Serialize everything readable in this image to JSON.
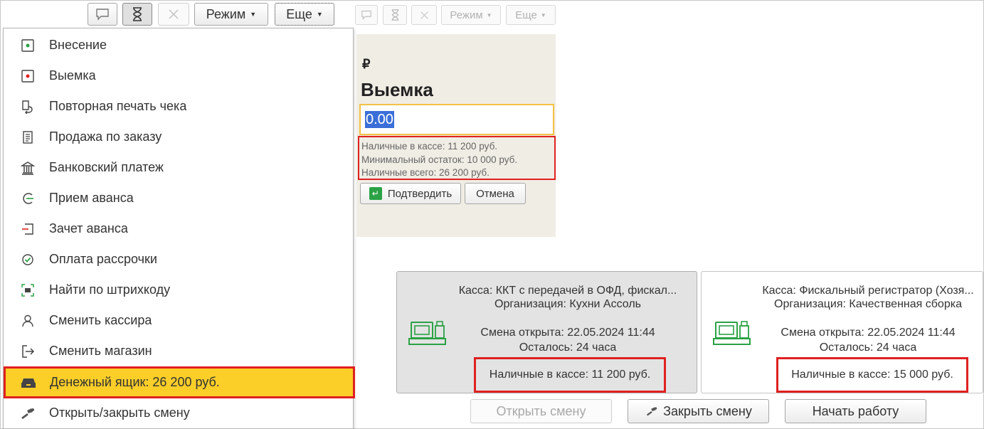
{
  "toolbar": {
    "mode_label": "Режим",
    "more_label": "Еще"
  },
  "menu": {
    "items": [
      {
        "label": "Внесение",
        "icon": "cash-in-icon"
      },
      {
        "label": "Выемка",
        "icon": "cash-out-icon"
      },
      {
        "label": "Повторная печать чека",
        "icon": "reprint-receipt-icon"
      },
      {
        "label": "Продажа по заказу",
        "icon": "order-sale-icon"
      },
      {
        "label": "Банковский платеж",
        "icon": "bank-icon"
      },
      {
        "label": "Прием аванса",
        "icon": "advance-receive-icon"
      },
      {
        "label": "Зачет аванса",
        "icon": "advance-offset-icon"
      },
      {
        "label": "Оплата рассрочки",
        "icon": "installment-icon"
      },
      {
        "label": "Найти по штрихкоду",
        "icon": "barcode-icon"
      },
      {
        "label": "Сменить кассира",
        "icon": "user-icon"
      },
      {
        "label": "Сменить магазин",
        "icon": "exit-icon"
      },
      {
        "label": "Денежный ящик: 26 200 руб.",
        "icon": "cash-drawer-icon"
      },
      {
        "label": "Открыть/закрыть смену",
        "icon": "shift-icon"
      }
    ]
  },
  "withdraw": {
    "currency_symbol": "₽",
    "title": "Выемка",
    "amount": "0.00",
    "cash_in_register": "Наличные в кассе: 11 200 руб.",
    "minimum_balance": "Минимальный остаток: 10 000 руб.",
    "cash_total": "Наличные всего: 26 200 руб.",
    "confirm_label": "Подтвердить",
    "cancel_label": "Отмена"
  },
  "registers": [
    {
      "register": "Касса: ККТ с передачей в ОФД, фискал...",
      "organization": "Организация: Кухни Ассоль",
      "shift_opened": "Смена открыта: 22.05.2024 11:44",
      "remaining": "Осталось: 24 часа",
      "cash": "Наличные в кассе: 11 200 руб."
    },
    {
      "register": "Касса: Фискальный регистратор (Хозя...",
      "organization": "Организация: Качественная сборка",
      "shift_opened": "Смена открыта: 22.05.2024 11:44",
      "remaining": "Осталось: 24 часа",
      "cash": "Наличные в кассе: 15 000 руб."
    }
  ],
  "actions": {
    "open_shift": "Открыть смену",
    "close_shift": "Закрыть смену",
    "start_work": "Начать работу"
  },
  "colors": {
    "highlight": "#fbce28",
    "annotation": "#e02020",
    "accent_green": "#2aa245",
    "panel_bg": "#f0ede4"
  }
}
